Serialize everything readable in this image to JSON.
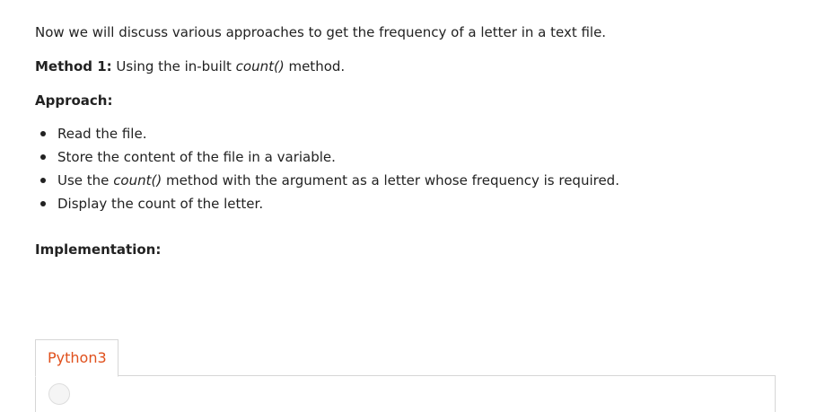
{
  "article": {
    "intro": "Now we will discuss various approaches to get the frequency of a letter in a text file.",
    "method": {
      "label": "Method 1:",
      "text_before": " Using the in-built ",
      "code": "count()",
      "text_after": " method."
    },
    "approach_heading": "Approach:",
    "bullets": [
      {
        "text": "Read the file."
      },
      {
        "text": "Store the content of the file in a variable."
      },
      {
        "before": "Use the ",
        "code": "count()",
        "after": " method with the argument as a letter whose frequency is required."
      },
      {
        "text": "Display the count of the letter."
      }
    ],
    "implementation_heading": "Implementation:"
  },
  "code_block": {
    "tabs": [
      {
        "label": "Python3"
      }
    ],
    "accent_color": "#e0501c"
  }
}
